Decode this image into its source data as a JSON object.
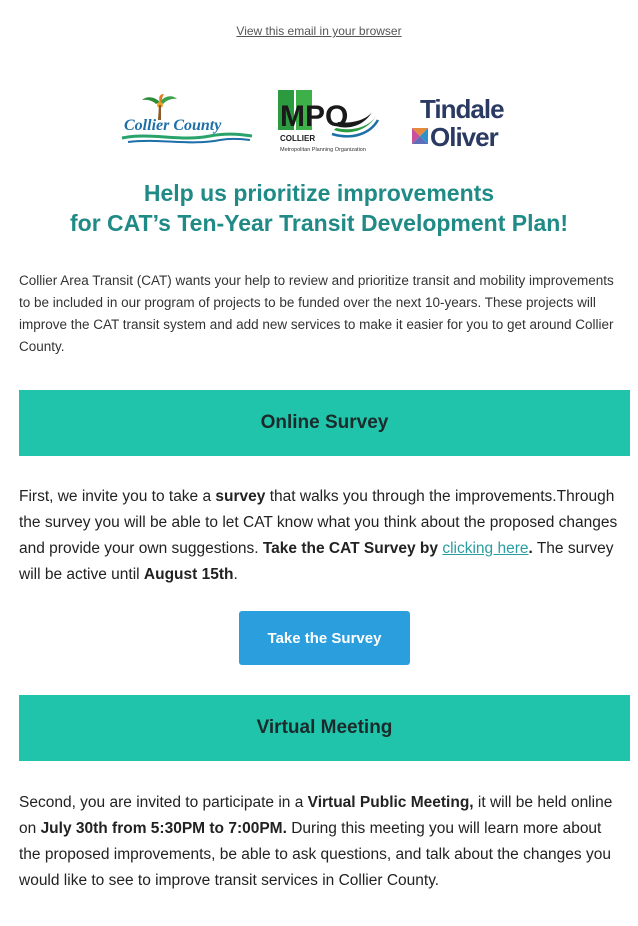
{
  "header": {
    "browser_link": "View this email in your browser"
  },
  "logos": {
    "collier_county": "Collier County",
    "mpo": "MPO",
    "mpo_sub1": "COLLIER",
    "mpo_sub2": "Metropolitan Planning Organization",
    "tindale_line1": "Tindale",
    "tindale_line2": "Oliver"
  },
  "headline": {
    "line1": "Help us prioritize improvements",
    "line2": "for CAT’s Ten-Year Transit Development Plan!"
  },
  "intro": "Collier Area Transit (CAT) wants your help to review and prioritize transit and mobility improvements to be included in our program of projects to be funded over the next 10-years. These projects will improve the CAT transit system and add new services to make it easier for you to get around Collier County.",
  "survey_section": {
    "title": "Online Survey",
    "p1": "First, we invite you to take a ",
    "p1_bold": "survey",
    "p2": " that walks you through the improvements.Through the survey you will be able to let CAT know what you think about the proposed changes and provide your own suggestions. ",
    "p2_bold": "Take the CAT Survey by ",
    "link": "clicking here",
    "p3_bold": ".",
    "p4": " The survey will be active until ",
    "p4_bold": "August 15th",
    "p5": ".",
    "button_label": "Take the Survey"
  },
  "meeting_section": {
    "title": "Virtual Meeting",
    "p1": "Second, you are invited to participate in a ",
    "p1_bold": "Virtual Public Meeting,",
    "p2": " it will be held online on ",
    "p2_bold": "July 30th from 5:30PM to 7:00PM.",
    "p3": " During this meeting you will learn more about the proposed improvements, be able to ask questions, and talk about the changes you would like to see to improve transit services in Collier County."
  },
  "colors": {
    "headline": "#1f8a86",
    "section_bar": "#1fc4ab",
    "button": "#2b9fdd",
    "link": "#2a9da0"
  }
}
